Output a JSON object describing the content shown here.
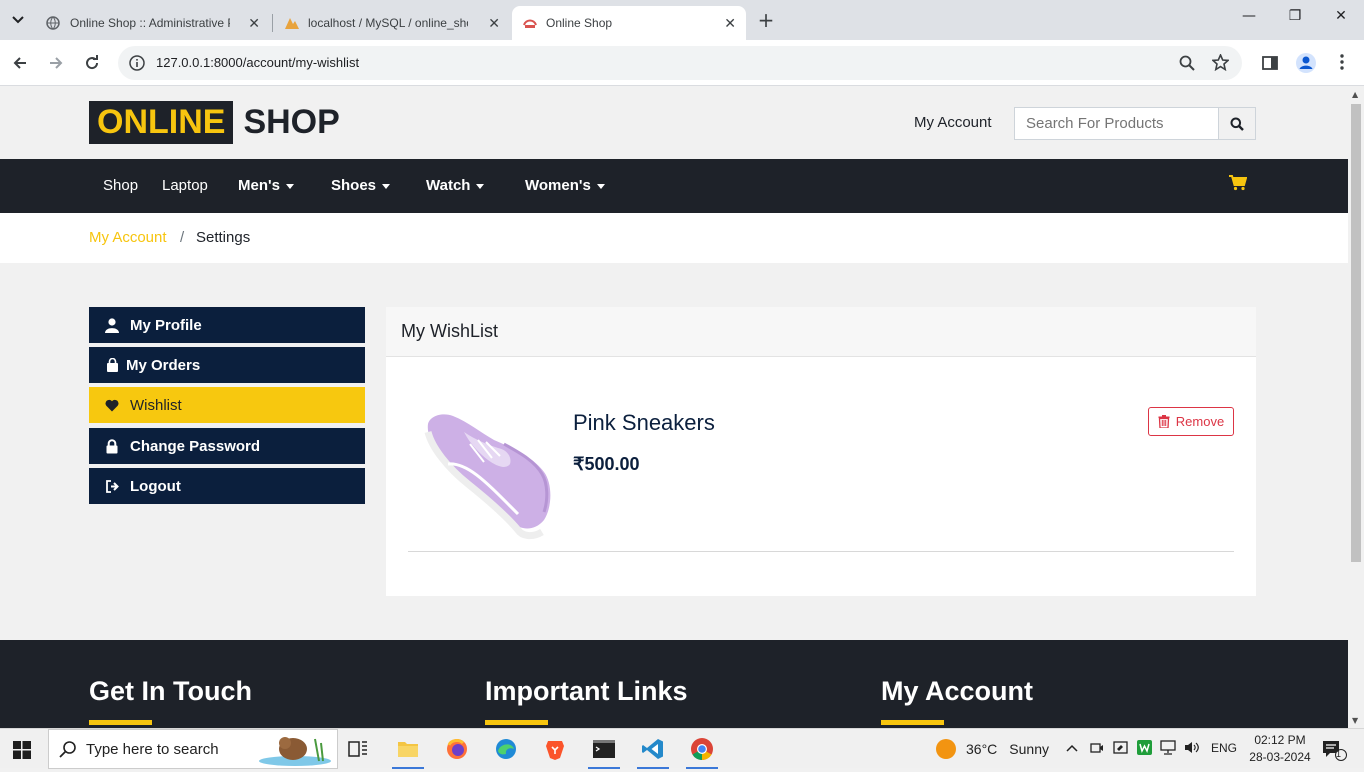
{
  "browser": {
    "tabs": [
      {
        "title": "Online Shop :: Administrative Pa",
        "close": "✕"
      },
      {
        "title": "localhost / MySQL / online_shop",
        "close": "✕"
      },
      {
        "title": "Online Shop",
        "close": "✕"
      }
    ],
    "new_tab": "+",
    "url": "127.0.0.1:8000/account/my-wishlist",
    "window_controls": {
      "minimize": "—",
      "maximize": "❐",
      "close": "✕"
    }
  },
  "header": {
    "logo_part1": "ONLINE",
    "logo_part2": "SHOP",
    "my_account": "My Account",
    "search_placeholder": "Search For Products"
  },
  "nav": {
    "items": [
      {
        "label": "Shop"
      },
      {
        "label": "Laptop"
      },
      {
        "label": "Men's"
      },
      {
        "label": "Shoes"
      },
      {
        "label": "Watch"
      },
      {
        "label": "Women's"
      }
    ]
  },
  "breadcrumb": {
    "parent": "My Account",
    "separator": "/",
    "current": "Settings"
  },
  "sidebar": {
    "items": [
      {
        "label": "My Profile",
        "icon": "user-icon"
      },
      {
        "label": "My Orders",
        "icon": "bag-icon"
      },
      {
        "label": "Wishlist",
        "icon": "heart-icon"
      },
      {
        "label": "Change Password",
        "icon": "lock-icon"
      },
      {
        "label": "Logout",
        "icon": "logout-icon"
      }
    ]
  },
  "wishlist": {
    "title": "My WishList",
    "items": [
      {
        "name": "Pink Sneakers",
        "price": "₹500.00",
        "remove_label": "Remove"
      }
    ]
  },
  "footer": {
    "headings": [
      "Get In Touch",
      "Important Links",
      "My Account"
    ]
  },
  "taskbar": {
    "search_placeholder": "Type here to search",
    "weather_temp": "36°C",
    "weather_text": "Sunny",
    "language": "ENG",
    "time": "02:12 PM",
    "date": "28-03-2024",
    "notification_count": "1"
  },
  "colors": {
    "accent": "#f7c50f",
    "dark": "#1e2229",
    "navy": "#0b1f3d",
    "danger": "#dc3545"
  }
}
